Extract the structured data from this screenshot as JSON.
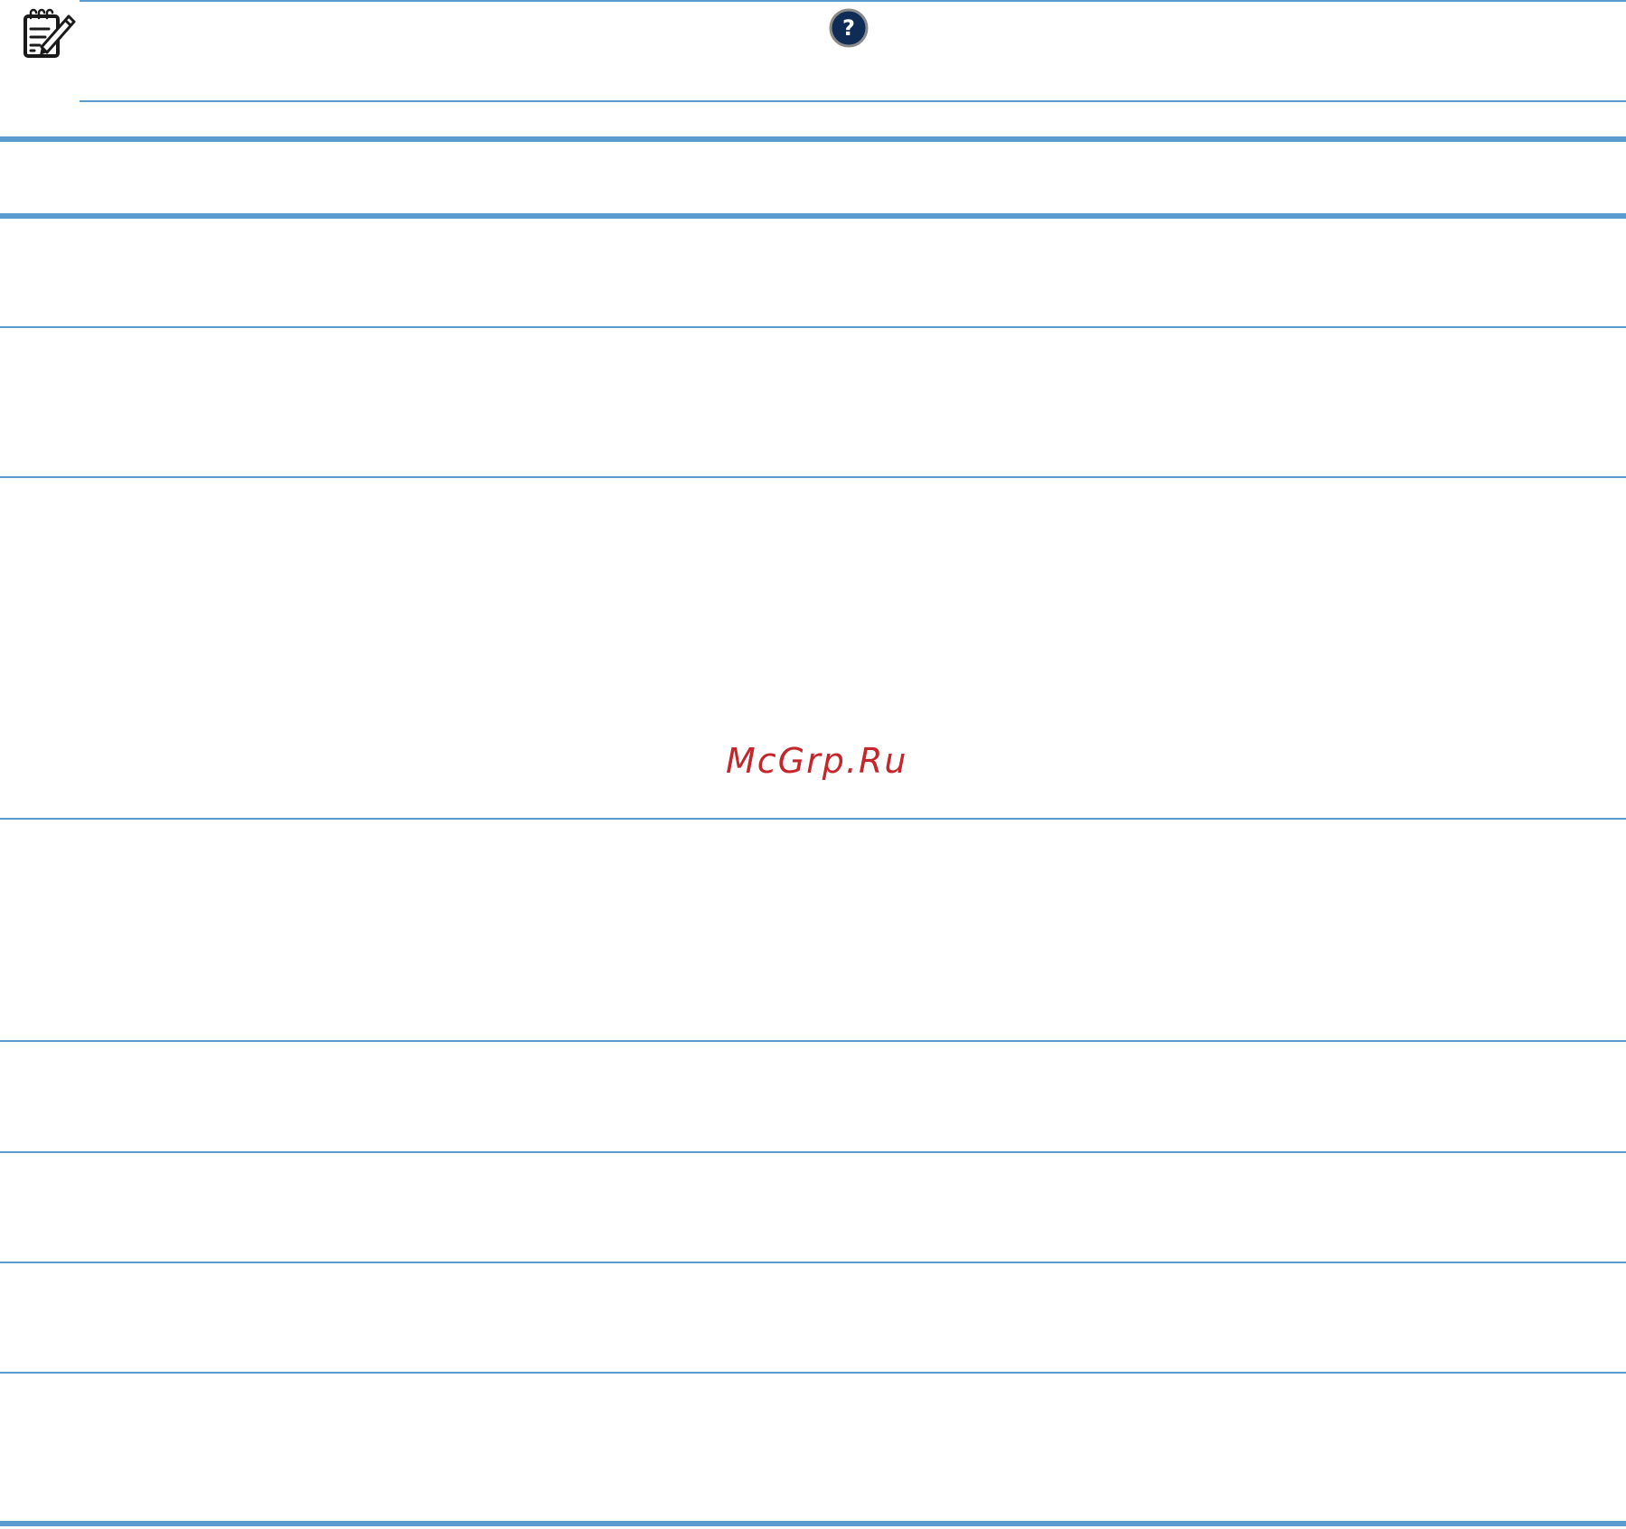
{
  "note": {
    "icon": "note-pencil-icon"
  },
  "help": {
    "icon": "help-icon",
    "glyph": "?"
  },
  "table": {
    "row_count": 8
  },
  "watermark": {
    "text": "McGrp.Ru"
  },
  "colors": {
    "rule": "#5b9bd0",
    "help_fill": "#0f2c57",
    "watermark": "#c4262b"
  }
}
